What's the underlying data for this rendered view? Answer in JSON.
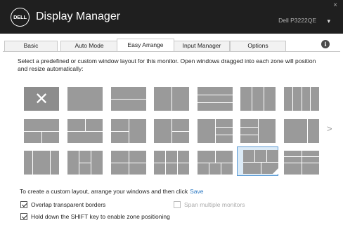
{
  "header": {
    "logo_text": "DELL",
    "app_title": "Display Manager",
    "close_glyph": "×",
    "monitor_name": "Dell P3222QE",
    "monitor_caret": "▾"
  },
  "tabs": [
    {
      "label": "Basic",
      "active": false
    },
    {
      "label": "Auto Mode",
      "active": false
    },
    {
      "label": "Easy Arrange",
      "active": true
    },
    {
      "label": "Input Manager",
      "active": false
    },
    {
      "label": "Options",
      "active": false
    }
  ],
  "info_glyph": "i",
  "description": "Select a predefined or custom window layout for this monitor.  Open windows dragged into each zone will position and resize automatically:",
  "next_arrow": ">",
  "custom": {
    "text": "To create a custom layout, arrange your windows and then click",
    "save_label": "Save"
  },
  "options": {
    "overlap_label": "Overlap transparent borders",
    "overlap_checked": true,
    "span_label": "Span multiple monitors",
    "span_checked": false,
    "span_enabled": false,
    "shift_label": "Hold down the SHIFT key to enable zone positioning",
    "shift_checked": true
  },
  "layouts_selected_index": 19,
  "colors": {
    "titlebar": "#1f1f1f",
    "zone_gray": "#9a9a9a",
    "selection_border": "#5b9bd5",
    "link_blue": "#2b78c2"
  }
}
